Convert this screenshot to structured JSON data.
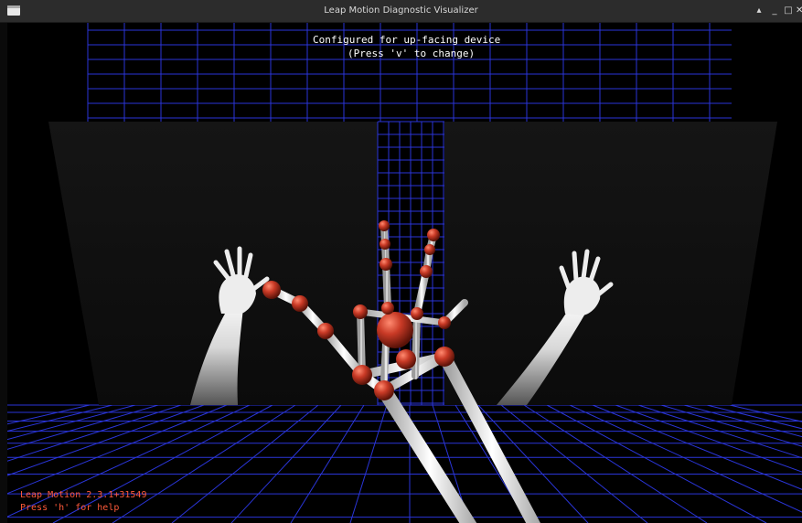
{
  "window": {
    "title": "Leap Motion Diagnostic Visualizer",
    "controls": {
      "shade": "▴",
      "minimize": "_",
      "maximize": "□",
      "close": "✕"
    }
  },
  "overlay": {
    "line1": "Configured for up-facing device",
    "line2": "(Press 'v' to change)"
  },
  "status": {
    "version": "Leap Motion 2.3.1+31549",
    "help": "Press 'h' for help"
  },
  "colors": {
    "grid": "#2a35d8",
    "joint": "#c93a26",
    "bone": "#ececec",
    "status_text": "#ff5a3a",
    "overlay_text": "#ffffff"
  },
  "icons": [
    "app-window-icon",
    "shade-icon",
    "minimize-icon",
    "maximize-icon",
    "close-icon"
  ]
}
